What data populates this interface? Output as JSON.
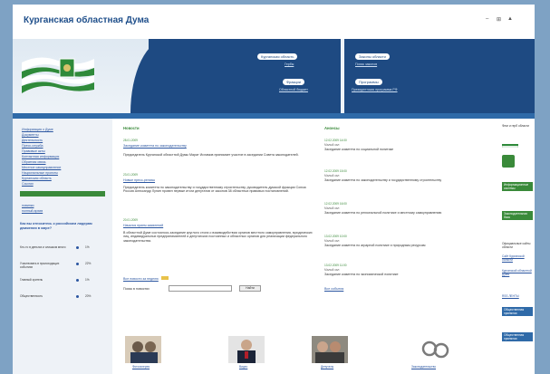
{
  "header": {
    "site_title": "Курганская областная Дума",
    "controls": [
      "–",
      "⊞",
      "▲"
    ]
  },
  "banner": {
    "pill_1": "Курганская область",
    "link_1": "Гербы",
    "pill_2": "Законы области",
    "link_2": "Поиск законов",
    "pill_3": "Фракции",
    "link_3": "Областной бюджет",
    "pill_4": "Программы",
    "link_4": "Президентская программа РФ"
  },
  "sidebar": {
    "links": [
      "Информация о Думе",
      "Документы",
      "Деятельность",
      "Пресс-служба",
      "Правовые акты",
      "Контактная информация",
      "Обратная связь",
      "Местное самоуправление",
      "Национальные проекты",
      "Курганская область",
      "Ссылки"
    ],
    "section_head": "",
    "links_2": [
      "новинки",
      "полный архив"
    ],
    "poll_title": "Как вы относитесь к российским лидерам движения в мире?",
    "poll": [
      {
        "q": "Кто-то в деньгах и слишком много",
        "pct": "1%"
      },
      {
        "q": "Участвовать в происходящих событиях",
        "pct": "22%"
      },
      {
        "q": "Главный зритель",
        "pct": "1%"
      },
      {
        "q": "Общественность",
        "pct": "20%"
      }
    ]
  },
  "news": {
    "heading": "Новости",
    "items": [
      {
        "date": "28.01.2009",
        "title": "Заседание комитета по законодательству",
        "text": "Председатель Курганской областной Думы Марат Исламов принимает участие в заседании Совета законодателей."
      },
      {
        "date": "23.01.2009",
        "title": "Новые пресс-релизы",
        "text": "Председатель комитета по законодательству и государственному строительству, руководитель думской фракции Союза Россия Александр Лунин провел первые итоги депутатов от законов 38 областных правовых постановлений."
      },
      {
        "date": "20.01.2009",
        "title": "Начался прием заявлений",
        "text": "В областной Думе состоялось заседание круглого стола о взаимодействии органов местного самоуправления, юридических лиц, индивидуальных предпринимателей и депутатских постоянных и областных органов для реализации федерального законодательства."
      }
    ],
    "all_news": "Все новости за неделю",
    "search_label": "Поиск в новостях",
    "search_button": "Найти"
  },
  "announcements": {
    "heading": "Анонсы",
    "items": [
      {
        "date": "12.02.2009 14:00",
        "sub": "Малый зал",
        "text": "Заседание комитета по социальной политике"
      },
      {
        "date": "12.02.2009 15:00",
        "sub": "Малый зал",
        "text": "Заседание комитета по законодательству и государственному строительству"
      },
      {
        "date": "12.02.2009 16:00",
        "sub": "Малый зал",
        "text": "Заседание комитета по региональной политике и местному самоуправлению"
      },
      {
        "date": "13.02.2009 10:00",
        "sub": "Малый зал",
        "text": "Заседание комитета по аграрной политике и природным ресурсам"
      },
      {
        "date": "13.02.2009 11:00",
        "sub": "Малый зал",
        "text": "Заседание комитета по экономической политике"
      }
    ],
    "all": "Все события"
  },
  "thumbs": [
    {
      "caption": "Фотогалерея"
    },
    {
      "caption": "Видео"
    },
    {
      "caption": "Депутаты"
    },
    {
      "caption": "Законодательство"
    }
  ],
  "right": {
    "top_text": "Флаг и герб области",
    "green_box_1": "Информационные системы",
    "green_box_2": "Законодательная база",
    "mid_text": "Официальные сайты области",
    "link_1": "Сайт Курганской области",
    "link_2": "Курганской областной Думы",
    "rss": "RSS ЛЕНТЫ",
    "blue_box_1": "Общественная приемная",
    "blue_box_2": "Общественная приемная"
  },
  "colors": {
    "banner_blue": "#1e4a82",
    "accent_green": "#3a8a3a",
    "link_blue": "#2a55a0",
    "background": "#7ea2c4"
  }
}
